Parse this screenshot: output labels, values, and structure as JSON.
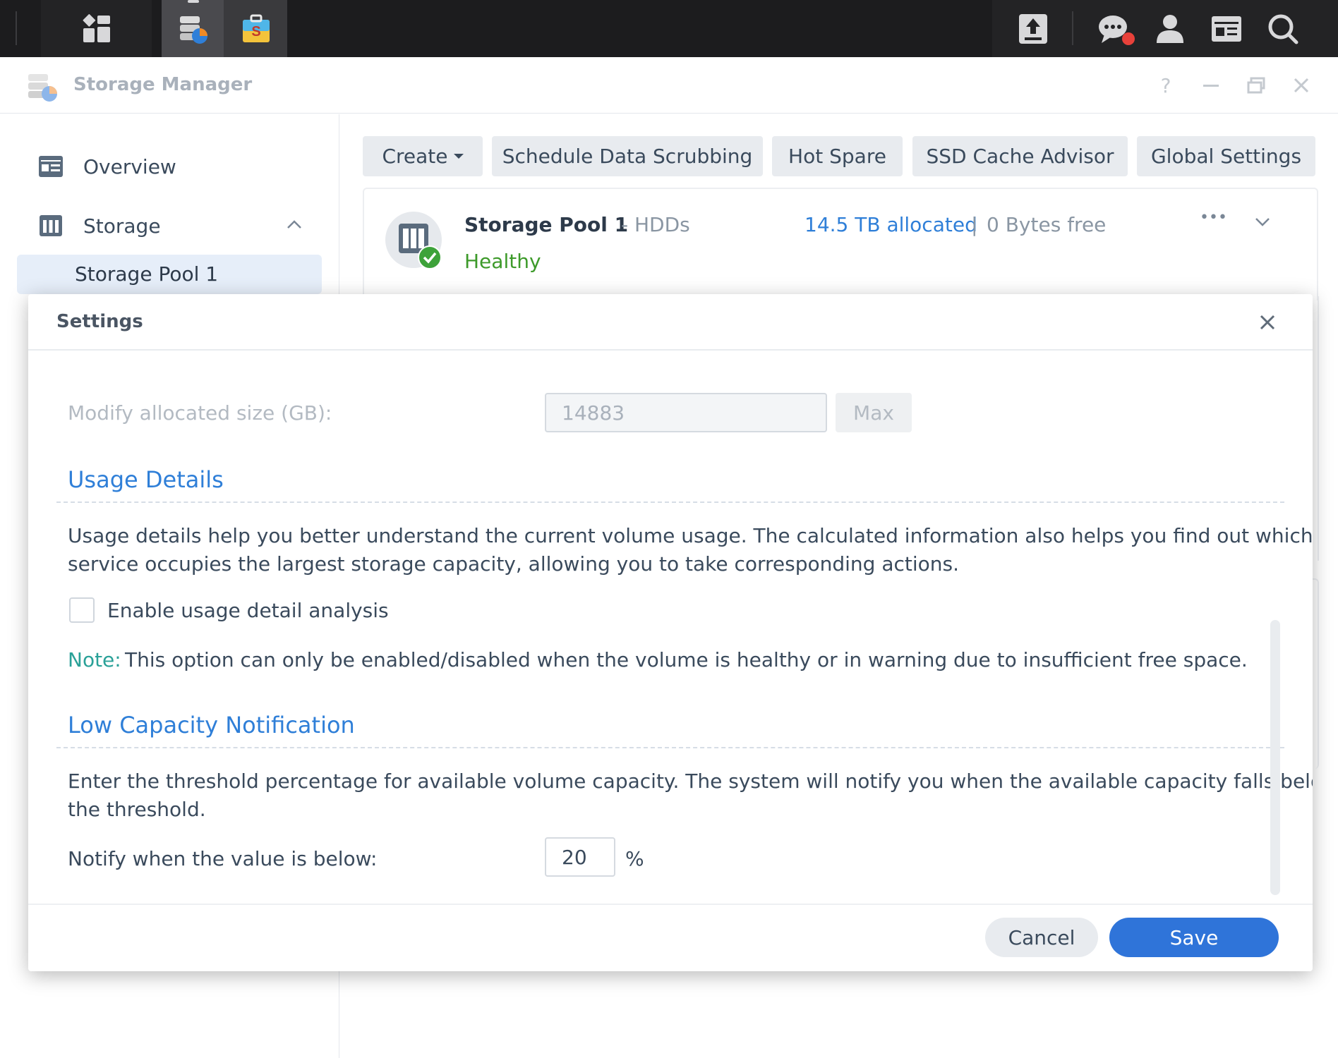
{
  "app": {
    "window_title": "Storage Manager"
  },
  "window_controls": {
    "help": "?",
    "minimize": "—",
    "restore": "",
    "close": "✕"
  },
  "sidebar": {
    "items": [
      {
        "label": "Overview"
      },
      {
        "label": "Storage"
      }
    ],
    "subitems": [
      {
        "label": "Storage Pool 1"
      }
    ]
  },
  "toolbar": {
    "create": "Create",
    "scrub": "Schedule Data Scrubbing",
    "hot_spare": "Hot Spare",
    "ssd_advisor": "SSD Cache Advisor",
    "global_settings": "Global Settings"
  },
  "pool": {
    "name": "Storage Pool 1",
    "type": "- HDDs",
    "status": "Healthy",
    "allocated": "14.5 TB allocated",
    "separator": "|",
    "free": "0 Bytes free",
    "more": "•••"
  },
  "modal": {
    "title": "Settings",
    "allocated_label": "Modify allocated size (GB):",
    "allocated_value": "14883",
    "max_button": "Max",
    "usage_title": "Usage Details",
    "usage_desc_line1": "Usage details help you better understand the current volume usage. The calculated information also helps you find out which",
    "usage_desc_line2": "service occupies the largest storage capacity, allowing you to take corresponding actions.",
    "enable_usage_label": "Enable usage detail analysis",
    "enable_usage_checked": false,
    "note_label": "Note:",
    "note_text": "This option can only be enabled/disabled when the volume is healthy or in warning due to insufficient free space.",
    "lowcap_title": "Low Capacity Notification",
    "lowcap_desc_line1": "Enter the threshold percentage for available volume capacity. The system will notify you when the available capacity falls below",
    "lowcap_desc_line2": "the threshold.",
    "notify_label": "Notify when the value is below:",
    "notify_value": "20",
    "notify_unit": "%",
    "cancel": "Cancel",
    "save": "Save"
  },
  "colors": {
    "accent": "#2f7fd8",
    "healthy": "#3d9a2a",
    "note": "#2aa198",
    "save_button": "#2f74d9",
    "taskbar": "#1c1c1e"
  }
}
